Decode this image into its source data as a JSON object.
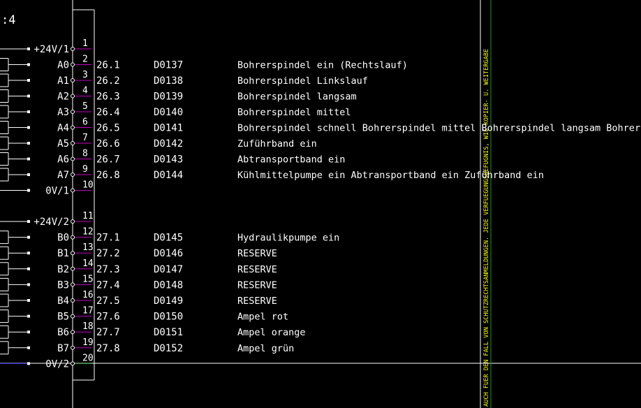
{
  "corner_label": ":4",
  "supply_rails": [
    {
      "label": "+24V/1",
      "pin": "1"
    },
    {
      "label": "0V/1",
      "pin": "10"
    },
    {
      "label": "+24V/2",
      "pin": "11"
    },
    {
      "label": "0V/2",
      "pin": "20"
    }
  ],
  "rows": [
    {
      "pin": "2",
      "channel": "A0",
      "ref": "26.1",
      "address": "D0137",
      "desc": "Bohrerspindel ein (Rechtslauf)"
    },
    {
      "pin": "3",
      "channel": "A1",
      "ref": "26.2",
      "address": "D0138",
      "desc": "Bohrerspindel Linkslauf"
    },
    {
      "pin": "4",
      "channel": "A2",
      "ref": "26.3",
      "address": "D0139",
      "desc": "Bohrerspindel langsam"
    },
    {
      "pin": "5",
      "channel": "A3",
      "ref": "26.4",
      "address": "D0140",
      "desc": "Bohrerspindel mittel"
    },
    {
      "pin": "6",
      "channel": "A4",
      "ref": "26.5",
      "address": "D0141",
      "desc": "Bohrerspindel schnell Bohrerspindel mittel Bohrerspindel langsam Bohrers"
    },
    {
      "pin": "7",
      "channel": "A5",
      "ref": "26.6",
      "address": "D0142",
      "desc": "Zuführband ein"
    },
    {
      "pin": "8",
      "channel": "A6",
      "ref": "26.7",
      "address": "D0143",
      "desc": "Abtransportband ein"
    },
    {
      "pin": "9",
      "channel": "A7",
      "ref": "26.8",
      "address": "D0144",
      "desc": "Kühlmittelpumpe ein Abtransportband ein Zuführband ein"
    },
    {
      "pin": "12",
      "channel": "B0",
      "ref": "27.1",
      "address": "D0145",
      "desc": "Hydraulikpumpe ein"
    },
    {
      "pin": "13",
      "channel": "B1",
      "ref": "27.2",
      "address": "D0146",
      "desc": "RESERVE"
    },
    {
      "pin": "14",
      "channel": "B2",
      "ref": "27.3",
      "address": "D0147",
      "desc": "RESERVE"
    },
    {
      "pin": "15",
      "channel": "B3",
      "ref": "27.4",
      "address": "D0148",
      "desc": "RESERVE"
    },
    {
      "pin": "16",
      "channel": "B4",
      "ref": "27.5",
      "address": "D0149",
      "desc": "RESERVE"
    },
    {
      "pin": "17",
      "channel": "B5",
      "ref": "27.6",
      "address": "D0150",
      "desc": "Ampel rot"
    },
    {
      "pin": "18",
      "channel": "B6",
      "ref": "27.7",
      "address": "D0151",
      "desc": "Ampel orange"
    },
    {
      "pin": "19",
      "channel": "B7",
      "ref": "27.8",
      "address": "D0152",
      "desc": "Ampel grün"
    }
  ],
  "copyright_notice": "AUCH FUER DEN FALL VON SCHUTZRECHTSANMELDUNGEN. JEDE VERFUEGUNGSBEFUGNIS, WIE KOPIER- U. WEITERGABE",
  "colors": {
    "background": "#000000",
    "line": "#ffffff",
    "pin_marker": "#c000c0",
    "notice_text": "#ffff00",
    "notice_line": "#2e8b2e",
    "blue_wire": "#3030ff"
  }
}
